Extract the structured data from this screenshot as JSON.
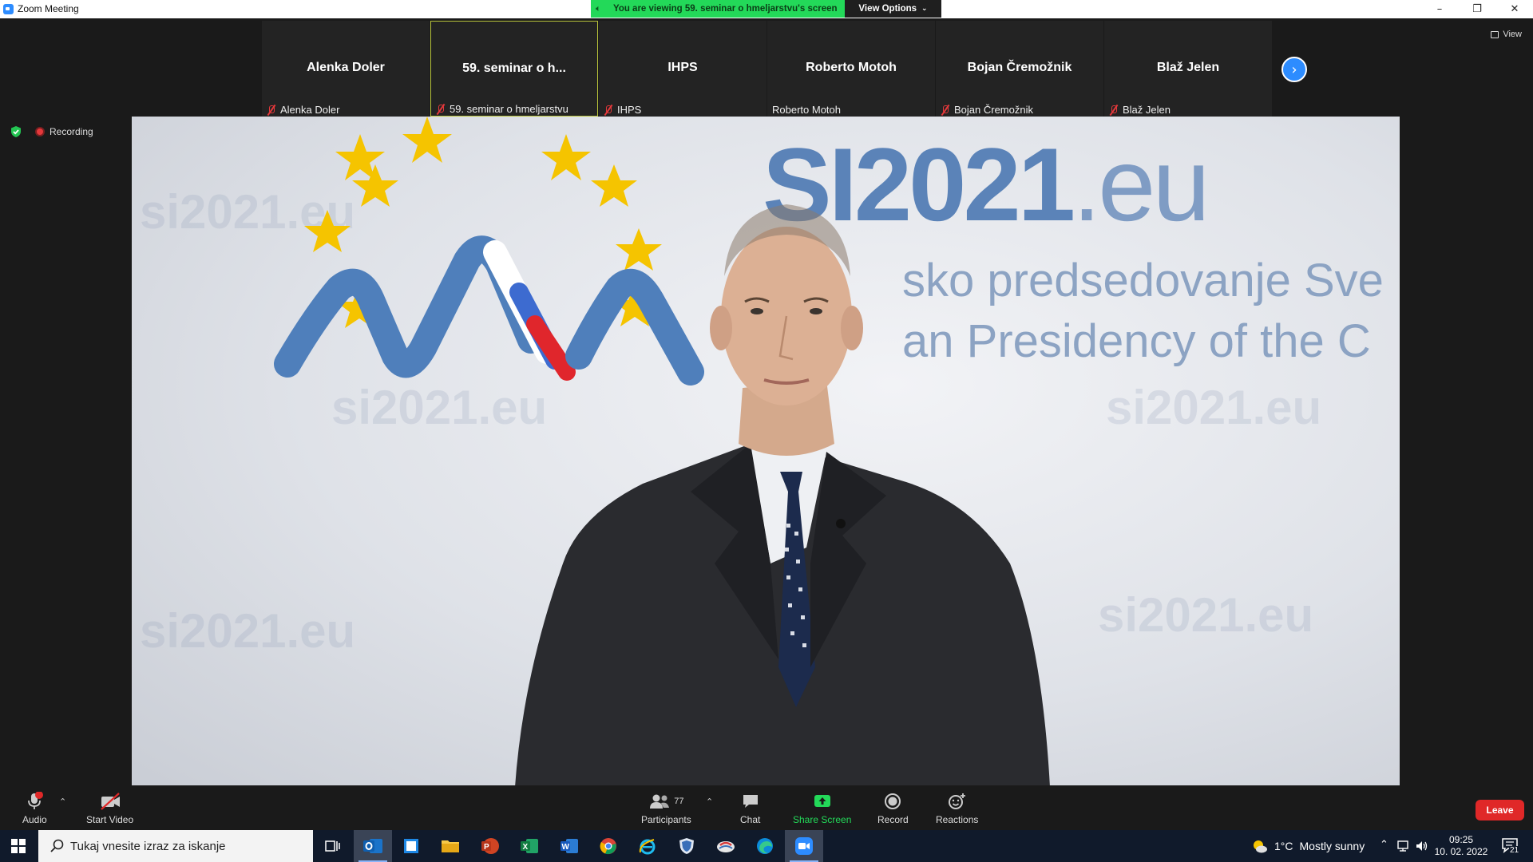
{
  "window": {
    "title": "Zoom Meeting",
    "minimize": "–",
    "restore": "❐",
    "close": "✕"
  },
  "share_banner": {
    "text": "You are viewing 59. seminar o hmeljarstvu's screen",
    "view_options": "View Options"
  },
  "view_button": "View",
  "participants_strip": [
    {
      "display": "Alenka Doler",
      "name": "Alenka Doler",
      "muted": true
    },
    {
      "display": "59. seminar o h...",
      "name": "59. seminar o hmeljarstvu",
      "muted": true,
      "active": true
    },
    {
      "display": "IHPS",
      "name": "IHPS",
      "muted": true
    },
    {
      "display": "Roberto Motoh",
      "name": "Roberto Motoh",
      "muted": false
    },
    {
      "display": "Bojan Čremožnik",
      "name": "Bojan Čremožnik",
      "muted": true
    },
    {
      "display": "Blaž Jelen",
      "name": "Blaž Jelen",
      "muted": true
    }
  ],
  "recording_label": "Recording",
  "video_backdrop": {
    "brand_bold": "SI2021",
    "brand_suffix": ".eu",
    "line1": "sko predsedovanje Sve",
    "line2": "an Presidency of the C",
    "watermark": "si2021.eu"
  },
  "toolbar": {
    "audio": "Audio",
    "audio_badge": "!",
    "start_video": "Start Video",
    "participants": "Participants",
    "participants_count": "77",
    "chat": "Chat",
    "share_screen": "Share Screen",
    "record": "Record",
    "reactions": "Reactions",
    "leave": "Leave"
  },
  "taskbar": {
    "search_placeholder": "Tukaj vnesite izraz za iskanje",
    "weather_temp": "1°C",
    "weather_text": "Mostly sunny",
    "time": "09:25",
    "date": "10. 02. 2022",
    "notification_count": "21"
  },
  "colors": {
    "share_green": "#23d959",
    "zoom_blue": "#2d8cff",
    "leave_red": "#e02828",
    "active_border": "#b8c33a",
    "taskbar_bg": "#101a2b"
  }
}
